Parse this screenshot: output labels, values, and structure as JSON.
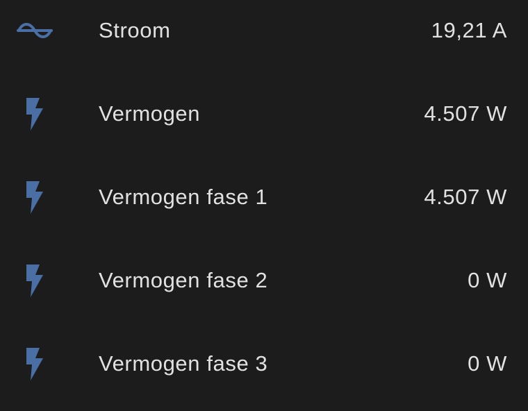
{
  "accent_color": "#4a6fa5",
  "rows": [
    {
      "icon": "sine-wave-icon",
      "label": "Stroom",
      "value": "19,21 A"
    },
    {
      "icon": "lightning-bolt-icon",
      "label": "Vermogen",
      "value": "4.507 W"
    },
    {
      "icon": "lightning-bolt-icon",
      "label": "Vermogen fase 1",
      "value": "4.507 W"
    },
    {
      "icon": "lightning-bolt-icon",
      "label": "Vermogen fase 2",
      "value": "0 W"
    },
    {
      "icon": "lightning-bolt-icon",
      "label": "Vermogen fase 3",
      "value": "0 W"
    }
  ]
}
